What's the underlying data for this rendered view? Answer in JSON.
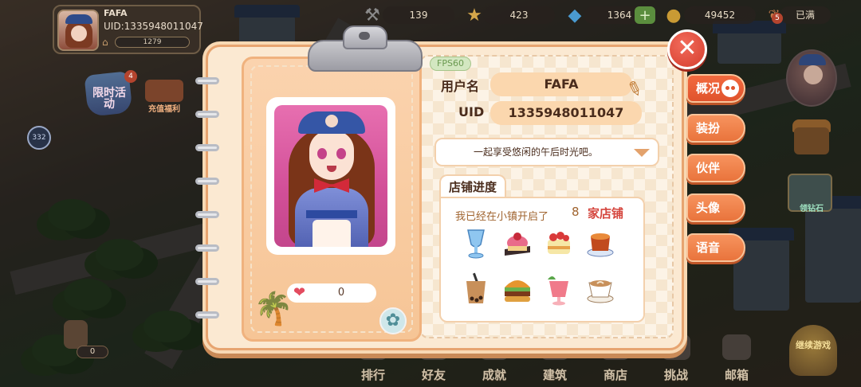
{
  "player": {
    "name": "FAFA",
    "uid": "UID:1335948011047",
    "level_value": "1279"
  },
  "resources": [
    {
      "icon": "hammer-icon",
      "value": "139"
    },
    {
      "icon": "star-icon",
      "value": "423"
    },
    {
      "icon": "diamond-icon",
      "value": "1364"
    },
    {
      "icon": "coin-icon",
      "value": "49452"
    },
    {
      "icon": "energy-icon",
      "value": "已满",
      "badge": "5"
    }
  ],
  "side_left": {
    "float_badge": "332",
    "event_label": "限时活动",
    "event_badge": "4",
    "recharge_label": "充值福利",
    "heart_count": "0"
  },
  "side_right": {
    "gem_label": "领钻石"
  },
  "bottom_nav": [
    "排行",
    "好友",
    "成就",
    "建筑",
    "商店",
    "挑战",
    "邮箱"
  ],
  "continue_label": "继续游戏",
  "profile": {
    "fps": "FPS60",
    "username_label": "用户名",
    "username": "FAFA",
    "uid_label": "UID",
    "uid": "1335948011047",
    "motto": "一起享受悠闲的午后时光吧。",
    "like_count": "0",
    "shop_tab": "店铺进度",
    "shop_line": "我已经在小镇开启了",
    "shop_count": "8",
    "shop_unit": "家店铺",
    "dishes": [
      "blue-drink-icon",
      "pastry-icon",
      "strawberry-cake-icon",
      "pudding-icon",
      "bubble-tea-icon",
      "burger-icon",
      "strawberry-smoothie-icon",
      "latte-icon"
    ]
  },
  "tabs": [
    "概况",
    "装扮",
    "伙伴",
    "头像",
    "语音"
  ],
  "colors": {
    "accent": "#e9743c",
    "panel": "#fbe9d2",
    "close": "#d53d2d"
  }
}
